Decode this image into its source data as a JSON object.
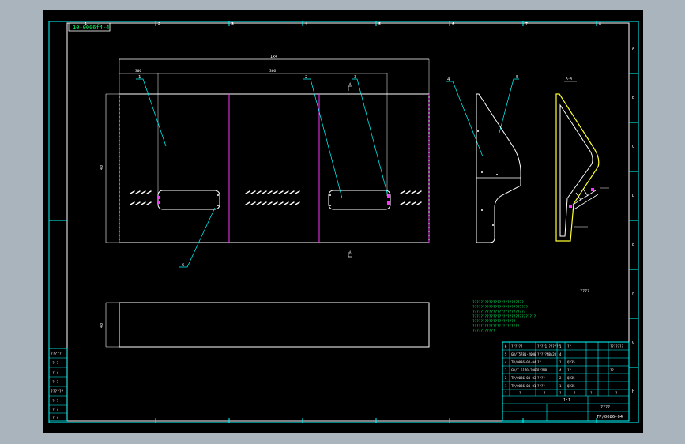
{
  "drawing": {
    "code_box": "10-0006f4-4",
    "section_label": "A-A",
    "note_label": "????",
    "dims": {
      "overall": "1x4",
      "left_segment": "306",
      "middle_segment": "306",
      "height_front": "40",
      "height_bottom": "40"
    },
    "balloons": [
      "1",
      "2",
      "3",
      "4",
      "5",
      "6"
    ],
    "border_marks_top": [
      "1",
      "2",
      "3",
      "4",
      "5",
      "6",
      "7",
      "8"
    ],
    "border_marks_right": [
      "A",
      "B",
      "C",
      "D",
      "E",
      "F",
      "G",
      "H"
    ],
    "left_table": [
      "?????",
      "? ?",
      "? ?",
      "? ?",
      "??????",
      "? ?",
      "? ?",
      "? ?"
    ]
  },
  "notes": [
    "?????????????????????????",
    "???????????????????????????",
    "??????????????????????????",
    "???????????????????????????????",
    "?????????????????????",
    "???????????????????????",
    "???????????"
  ],
  "title_block": {
    "rows": [
      [
        "6",
        "??????",
        "????1 ??????",
        "1",
        "??",
        "",
        "???????"
      ],
      [
        "5",
        "GB/T5781-2000",
        "?????M8x20",
        "4",
        "",
        "",
        ""
      ],
      [
        "4",
        "TP/0086-04-04",
        "??",
        "1",
        "Q235",
        "",
        ""
      ],
      [
        "3",
        "GB/T 6170-2000",
        "???M8",
        "4",
        "??",
        "",
        "??"
      ],
      [
        "2",
        "TP/0086-04-03",
        "????",
        "2",
        "Q235",
        "",
        ""
      ],
      [
        "1",
        "TP/0086-04-01",
        "????",
        "1",
        "Q235",
        "",
        ""
      ]
    ],
    "header": [
      "?",
      "?",
      "?",
      "?",
      "?",
      "?",
      "?"
    ],
    "scale": "1:1",
    "sheet": "????",
    "drawing_no": "TP/0086-04"
  }
}
